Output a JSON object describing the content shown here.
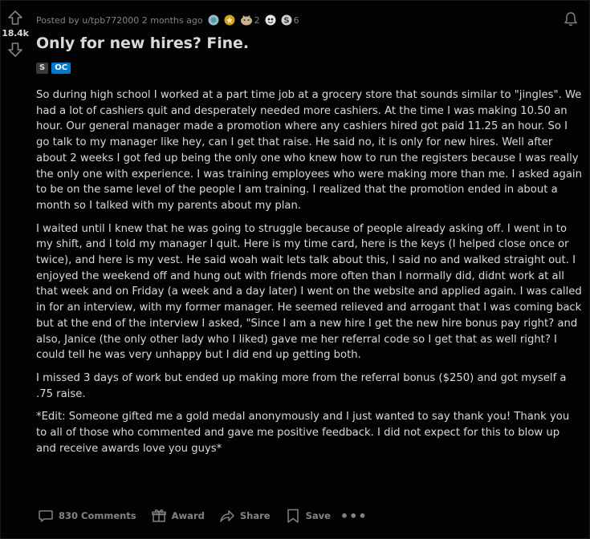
{
  "post": {
    "score": "18.4k",
    "posted_by": "Posted by u/tpb772000 2 months ago",
    "awards": [
      {
        "icon": "silver-award-icon",
        "count": ""
      },
      {
        "icon": "gold-award-icon",
        "count": ""
      },
      {
        "icon": "wholesome-award-icon",
        "count": "2"
      },
      {
        "icon": "heartwarming-award-icon",
        "count": ""
      },
      {
        "icon": "helpful-award-icon",
        "count": "6"
      }
    ],
    "title": "Only for new hires? Fine.",
    "flairs": {
      "s": "S",
      "oc": "OC"
    },
    "paragraphs": [
      "So during high school I worked at a part time job at a grocery store that sounds similar to \"jingles\". We had a lot of cashiers quit and desperately needed more cashiers. At the time I was making 10.50 an hour. Our general manager made a promotion where any cashiers hired got paid 11.25 an hour. So I go talk to my manager like hey, can I get that raise. He said no, it is only for new hires. Well after about 2 weeks I got fed up being the only one who knew how to run the registers because I was really the only one with experience. I was training employees who were making more than me. I asked again to be on the same level of the people I am training. I realized that the promotion ended in about a month so I talked with my parents about my plan.",
      "I waited until I knew that he was going to struggle because of people already asking off. I went in to my shift, and I told my manager I quit. Here is my time card, here is the keys (I helped close once or twice), and here is my vest. He said woah wait lets talk about this, I said no and walked straight out. I enjoyed the weekend off and hung out with friends more often than I normally did, didnt work at all that week and on Friday (a week and a day later) I went on the website and applied again. I was called in for an interview, with my former manager. He seemed relieved and arrogant that I was coming back but at the end of the interview I asked, \"Since I am a new hire I get the new hire bonus pay right? and also, Janice (the only other lady who I liked) gave me her referral code so I get that as well right? I could tell he was very unhappy but I did end up getting both.",
      "I missed 3 days of work but ended up making more from the referral bonus ($250) and got myself a .75 raise.",
      "*Edit: Someone gifted me a gold medal anonymously and I just wanted to say thank you! Thank you to all of those who commented and gave me positive feedback. I did not expect for this to blow up and receive awards love you guys*"
    ],
    "actions": {
      "comments": "830 Comments",
      "award": "Award",
      "share": "Share",
      "save": "Save",
      "more": "•••"
    }
  },
  "colors": {
    "background": "#030303",
    "text": "#d7dadc",
    "muted": "#818384",
    "oc_flair": "#0079d3"
  }
}
